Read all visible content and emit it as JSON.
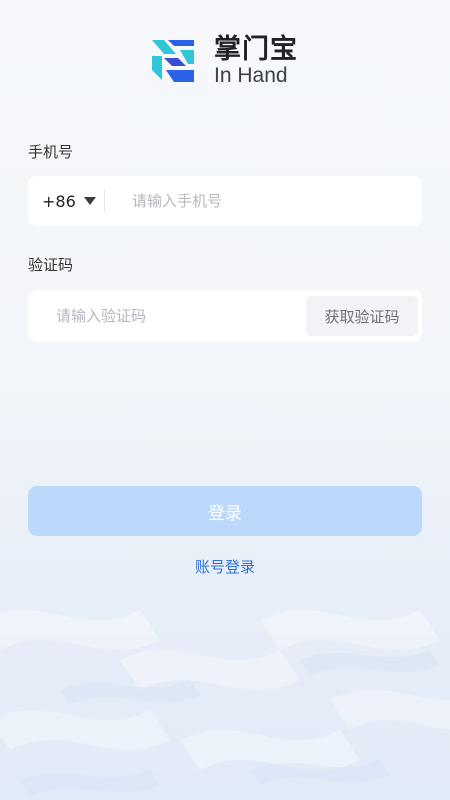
{
  "brand": {
    "name_cn": "掌门宝",
    "name_en": "In Hand",
    "colors": {
      "cyan": "#2fc6d8",
      "blue": "#2a63e8",
      "indigo": "#3a4fcf"
    }
  },
  "phone": {
    "label": "手机号",
    "country_code": "+86",
    "placeholder": "请输入手机号",
    "value": ""
  },
  "code": {
    "label": "验证码",
    "placeholder": "请输入验证码",
    "value": "",
    "get_code_label": "获取验证码"
  },
  "actions": {
    "login_label": "登录",
    "account_login_label": "账号登录"
  },
  "theme": {
    "primary_disabled": "#bcd8fb",
    "link": "#2e6fd6"
  }
}
